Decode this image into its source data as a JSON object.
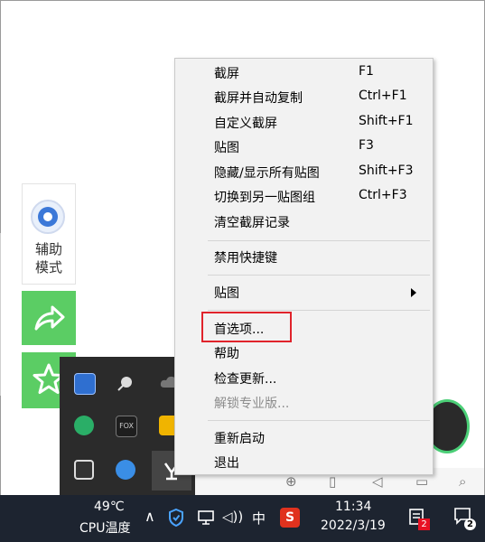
{
  "side_panel": {
    "assist_line1": "辅助",
    "assist_line2": "模式"
  },
  "menu": {
    "items": [
      {
        "label": "截屏",
        "shortcut": "F1"
      },
      {
        "label": "截屏并自动复制",
        "shortcut": "Ctrl+F1"
      },
      {
        "label": "自定义截屏",
        "shortcut": "Shift+F1"
      },
      {
        "label": "贴图",
        "shortcut": "F3"
      },
      {
        "label": "隐藏/显示所有贴图",
        "shortcut": "Shift+F3"
      },
      {
        "label": "切换到另一贴图组",
        "shortcut": "Ctrl+F3"
      },
      {
        "label": "清空截屏记录",
        "shortcut": ""
      }
    ],
    "disable_hotkeys": "禁用快捷键",
    "sticker_submenu": "贴图",
    "preferences": "首选项...",
    "help": "帮助",
    "check_updates": "检查更新...",
    "unlock_pro": "解锁专业版...",
    "restart": "重新启动",
    "exit": "退出"
  },
  "taskbar": {
    "temperature": "49℃",
    "cpu_label": "CPU温度",
    "ime_mode": "中",
    "time": "11:34",
    "date": "2022/3/19",
    "notification_badge": "2",
    "action_center_badge": "2"
  },
  "tray_icons": [
    "remote-icon",
    "satellite-icon",
    "cloud-icon",
    "wechat-icon",
    "fox-icon",
    "yellow-app-icon",
    "screen-record-icon",
    "telegram-icon",
    "snipaste-icon"
  ],
  "colors": {
    "green_panel": "#5bcd64",
    "highlight_box": "#e0232b",
    "taskbar_bg": "#1d2430",
    "menu_bg": "#f2f2f2"
  }
}
